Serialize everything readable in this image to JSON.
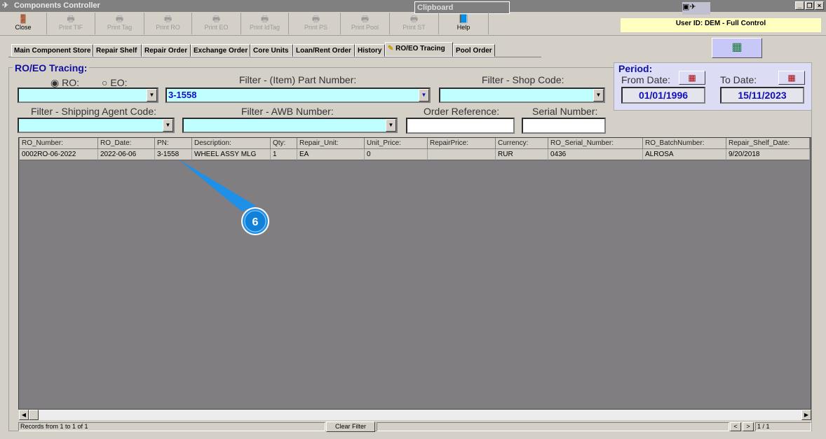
{
  "window": {
    "title": "Components Controller",
    "clipboard_label": "Clipboard"
  },
  "toolbar": [
    {
      "label": "Close",
      "icon": "door-exit-icon",
      "enabled": true
    },
    {
      "label": "Print TIF",
      "icon": "printer-icon",
      "enabled": false
    },
    {
      "label": "Print Tag",
      "icon": "printer-icon",
      "enabled": false
    },
    {
      "label": "Print RO",
      "icon": "printer-icon",
      "enabled": false
    },
    {
      "label": "Print EO",
      "icon": "printer-icon",
      "enabled": false
    },
    {
      "label": "Print IdTag",
      "icon": "printer-icon",
      "enabled": false
    },
    {
      "label": "Print PS",
      "icon": "printer-icon",
      "enabled": false
    },
    {
      "label": "Print Pool",
      "icon": "printer-icon",
      "enabled": false
    },
    {
      "label": "Print ST",
      "icon": "printer-icon",
      "enabled": false
    },
    {
      "label": "Help",
      "icon": "help-book-icon",
      "enabled": true
    }
  ],
  "user_id": "User ID: DEM - Full Control",
  "tabs": [
    "Main Component Store",
    "Repair Shelf",
    "Repair Order",
    "Exchange Order",
    "Core Units",
    "Loan/Rent Order",
    "History",
    "RO/EO Tracing",
    "Pool Order"
  ],
  "active_tab": "RO/EO Tracing",
  "section_title": "RO/EO Tracing:",
  "radio": {
    "ro": "RO:",
    "eo": "EO:",
    "selected": "RO"
  },
  "filters": {
    "part_number_label": "Filter - (Item) Part Number:",
    "part_number_value": "3-1558",
    "shop_code_label": "Filter - Shop Code:",
    "shipping_agent_label": "Filter - Shipping Agent Code:",
    "awb_label": "Filter - AWB Number:",
    "order_ref_label": "Order Reference:",
    "serial_label": "Serial Number:"
  },
  "period": {
    "title": "Period:",
    "from_label": "From Date:",
    "from_value": "01/01/1996",
    "to_label": "To Date:",
    "to_value": "15/11/2023"
  },
  "grid": {
    "columns": [
      "RO_Number:",
      "RO_Date:",
      "PN:",
      "Description:",
      "Qty:",
      "Repair_Unit:",
      "Unit_Price:",
      "RepairPrice:",
      "Currency:",
      "RO_Serial_Number:",
      "RO_BatchNumber:",
      "Repair_Shelf_Date:"
    ],
    "rows": [
      [
        "0002RO-06-2022",
        "2022-06-06",
        "3-1558",
        "WHEEL ASSY MLG",
        "1",
        "EA",
        "0",
        "",
        "RUR",
        "0436",
        "ALROSA",
        "9/20/2018"
      ]
    ]
  },
  "status": {
    "records": "Records from 1 to 1 of 1",
    "clear_filter": "Clear Filter",
    "prev": "<",
    "next": ">",
    "page": "1 / 1"
  },
  "callout": {
    "number": "6",
    "color": "#1e90e8"
  }
}
